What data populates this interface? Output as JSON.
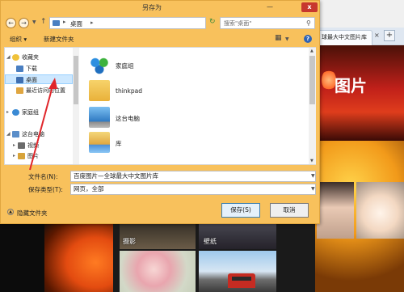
{
  "window": {
    "title": "另存为",
    "close_glyph": "x",
    "min_glyph": "—"
  },
  "address": {
    "path": "桌面",
    "search_placeholder": "搜索\"桌面\""
  },
  "toolbar": {
    "organize": "组织 ▾",
    "new_folder": "新建文件夹"
  },
  "nav": {
    "items": [
      {
        "label": "收藏夹"
      },
      {
        "label": "下载"
      },
      {
        "label": "桌面"
      },
      {
        "label": "最近访问的位置"
      },
      {
        "label": "家庭组"
      },
      {
        "label": "这台电脑"
      },
      {
        "label": "视频"
      },
      {
        "label": "图片"
      }
    ]
  },
  "files": {
    "items": [
      {
        "label": "家庭组",
        "icon": "homegroup-icon"
      },
      {
        "label": "thinkpad",
        "icon": "folder-icon"
      },
      {
        "label": "这台电脑",
        "icon": "computer-icon"
      },
      {
        "label": "库",
        "icon": "library-icon"
      }
    ]
  },
  "form": {
    "filename_label": "文件名(N):",
    "filename_value": "百度图片—全球最大中文图片库",
    "filetype_label": "保存类型(T):",
    "filetype_value": "网页，全部"
  },
  "footer": {
    "hide_folders": "隐藏文件夹",
    "save": "保存(S)",
    "cancel": "取消"
  },
  "background": {
    "tab_title": "球最大中文图片库",
    "tab_close": "×",
    "new_tab": "+",
    "logo_text": "图片",
    "thumb_labels": [
      "摄影",
      "壁纸"
    ]
  },
  "colors": {
    "dialog_frame": "#f8c15c",
    "close_button": "#c7372e",
    "selection": "#cde8ff",
    "annotation_arrow": "#e0262b"
  }
}
